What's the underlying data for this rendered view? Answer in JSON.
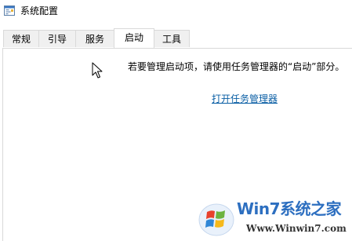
{
  "window": {
    "title": "系统配置",
    "icon": "msconfig-icon"
  },
  "tabs": [
    {
      "label": "常规",
      "active": false
    },
    {
      "label": "引导",
      "active": false
    },
    {
      "label": "服务",
      "active": false
    },
    {
      "label": "启动",
      "active": true
    },
    {
      "label": "工具",
      "active": false
    }
  ],
  "startup_panel": {
    "message": "若要管理启动项，请使用任务管理器的“启动”部分。",
    "link_label": "打开任务管理器",
    "link_color": "#0b5fa5"
  },
  "watermark": {
    "brand": "Win7系统之家",
    "url": "Www.Winwin7.com"
  }
}
